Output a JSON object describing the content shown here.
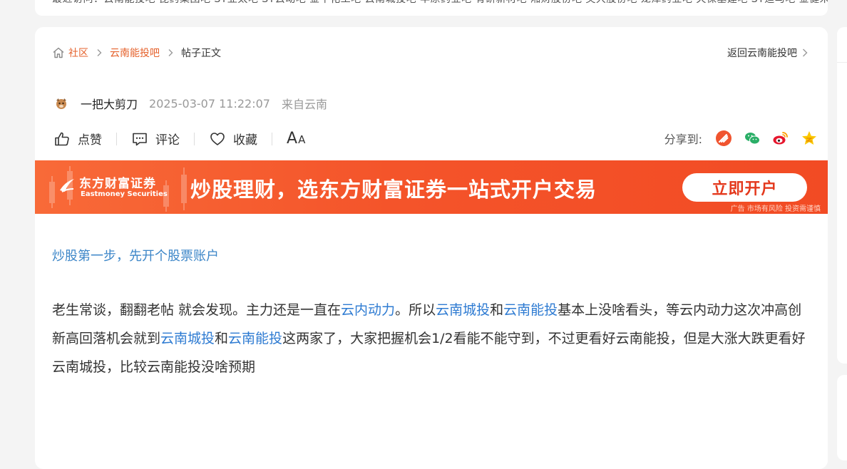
{
  "top_strip": {
    "text": "最近访问：云南能投吧 昆药集团吧 ST亚太吧 ST云动吧 金牛化工吧 云南城投吧 丰原药业吧 有研新材吧 湘财股份吧 英大股份吧 龙津药业吧 天保基建吧 ST迪马吧 金健米业吧"
  },
  "breadcrumb": {
    "home_icon": "home-icon",
    "items": [
      "社区",
      "云南能投吧"
    ],
    "current": "帖子正文",
    "back_label": "返回云南能投吧"
  },
  "author": {
    "name": "一把大剪刀",
    "time": "2025-03-07 11:22:07",
    "from": "来自云南"
  },
  "actions": {
    "like": "点赞",
    "comment": "评论",
    "favorite": "收藏",
    "font_big": "A",
    "font_small": "A"
  },
  "share": {
    "label": "分享到:",
    "icons": [
      "guba-share-icon",
      "wechat-icon",
      "weibo-icon",
      "qzone-icon"
    ]
  },
  "ad": {
    "brand": "东方财富证券",
    "brand_en": "Eastmoney Securities",
    "headline": "炒股理财，选东方财富证券一站式开户交易",
    "cta": "立即开户",
    "disclaimer": "广告 市场有风险 投资需谨慎"
  },
  "content": {
    "promo_link": "炒股第一步，先开个股票账户",
    "p1": "老生常谈，翻翻老帖  就会发现。主力还是一直在",
    "link1": "云内动力",
    "p2": "。所以",
    "link2": "云南城投",
    "p3": "和",
    "link3": "云南能投",
    "p4": "基本上没啥看头，等云内动力这次冲高创新高回落机会就到",
    "link4": "云南城投",
    "p5": "和",
    "link5": "云南能投",
    "p6": "这两家了，大家把握机会1/2看能不能守到，不过更看好云南能投，但是大涨大跌更看好云南城投，比较云南能投没啥预期"
  },
  "colors": {
    "accent": "#e5622c",
    "link": "#2e7bd2",
    "ad_bg": "#f4542a"
  }
}
